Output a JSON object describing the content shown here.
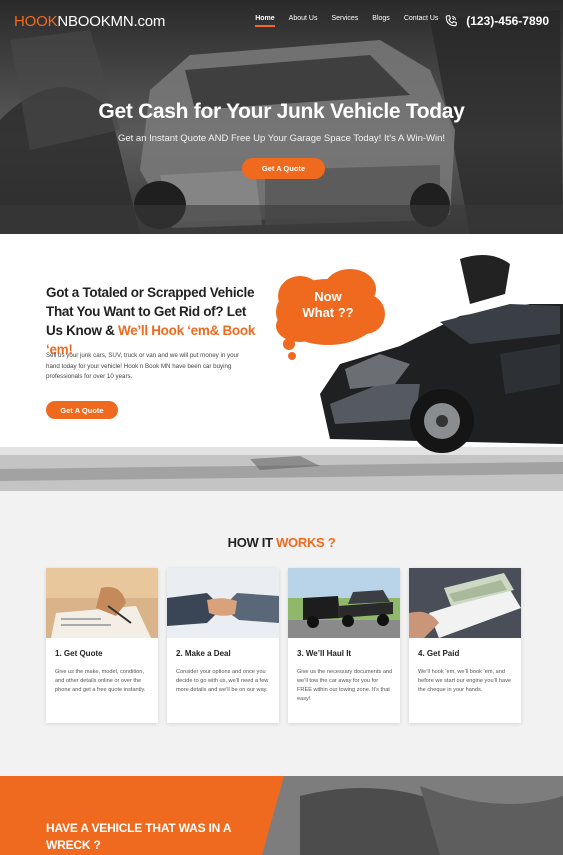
{
  "header": {
    "logo": {
      "part1": "HOOK",
      "part2": "NBOOKMN",
      "part3": ".com"
    },
    "nav": [
      {
        "label": "Home",
        "active": true
      },
      {
        "label": "About Us",
        "active": false
      },
      {
        "label": "Services",
        "active": false
      },
      {
        "label": "Blogs",
        "active": false
      },
      {
        "label": "Contact Us",
        "active": false
      }
    ],
    "phone": "(123)-456-7890",
    "phone_icon": "phone-icon"
  },
  "hero": {
    "title": "Get Cash for Your Junk Vehicle Today",
    "subtitle": "Get an Instant Quote AND Free Up Your Garage Space Today! It’s A Win-Win!",
    "button": "Get A Quote"
  },
  "intro": {
    "title_main": "Got a Totaled or Scrapped Vehicle That You Want to Get Rid of? Let Us Know &",
    "title_accent": "We’ll Hook ‘em& Book ‘em!",
    "body": "Sell us your junk cars, SUV, truck or van and we will put money in your hand today for your vehicle! Hook n Book MN have been car buying professionals for over 10 years.",
    "button": "Get A Quote",
    "cloud_line1": "Now",
    "cloud_line2": "What ??"
  },
  "how_it_works": {
    "title_main": "HOW IT",
    "title_accent": "WORKS ?",
    "steps": [
      {
        "title": "1.  Get Quote",
        "text": "Give us the make, model, condition, and other details online or over the phone and get a free quote instantly."
      },
      {
        "title": "2.  Make a Deal",
        "text": "Consider your options and once you decide to go with us, we’ll need a few more details and we’ll be on our way."
      },
      {
        "title": "3.  We’ll Haul It",
        "text": "Give us the necessary documents and we’ll tow the car away for you for FREE within our towing zone. It’s that easy!"
      },
      {
        "title": "4.  Get Paid",
        "text": "We’ll hook ‘em, we’ll book ‘em, and before we start our engine you’ll have the cheque in your hands."
      }
    ]
  },
  "wreck": {
    "title": "HAVE A VEHICLE THAT WAS IN A WRECK ?"
  },
  "colors": {
    "accent": "#ef6a1f",
    "dark": "#222222",
    "light_bg": "#f2f2f2"
  }
}
